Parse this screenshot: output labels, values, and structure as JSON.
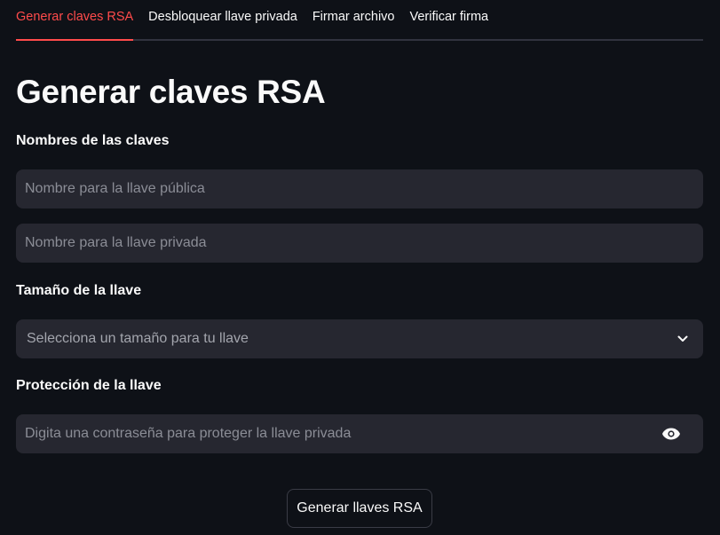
{
  "tabs": [
    {
      "label": "Generar claves RSA",
      "active": true
    },
    {
      "label": "Desbloquear llave privada",
      "active": false
    },
    {
      "label": "Firmar archivo",
      "active": false
    },
    {
      "label": "Verificar firma",
      "active": false
    }
  ],
  "main": {
    "title": "Generar claves RSA",
    "key_names_section": {
      "label": "Nombres de las claves",
      "public_key_placeholder": "Nombre para la llave pública",
      "private_key_placeholder": "Nombre para la llave privada"
    },
    "key_size_section": {
      "label": "Tamaño de la llave",
      "select_placeholder": "Selecciona un tamaño para tu llave",
      "icon": "chevron-down-icon"
    },
    "protection_section": {
      "label": "Protección de la llave",
      "password_placeholder": "Digita una contraseña para proteger la llave privada",
      "icon": "eye-icon"
    },
    "generate_button_label": "Generar llaves RSA"
  },
  "colors": {
    "background": "#0e1117",
    "field_background": "#262730",
    "accent": "#ff4b4b",
    "text": "#fafafa"
  }
}
